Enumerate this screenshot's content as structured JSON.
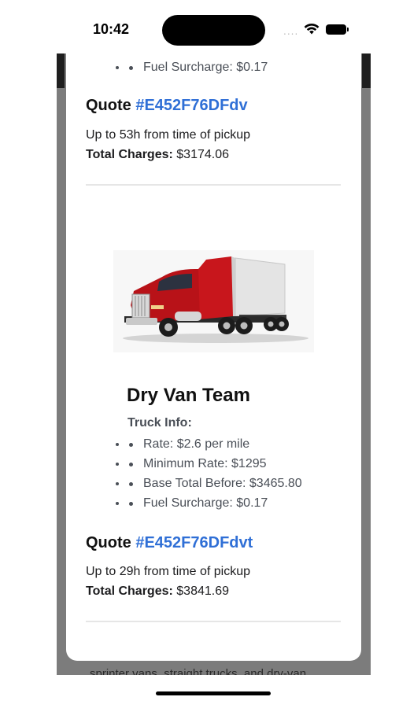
{
  "status_bar": {
    "time": "10:42",
    "signal_dots": "....",
    "icons": [
      "wifi-icon",
      "battery-icon"
    ]
  },
  "modal": {
    "top_list": [
      "Fuel Surcharge: $0.17"
    ],
    "quote1": {
      "prefix": "Quote",
      "id": "#E452F76DFdv",
      "pickup": "Up to 53h from time of pickup",
      "total_label": "Total Charges:",
      "total_value": "$3174.06"
    },
    "truck": {
      "image": "red-semi-truck-with-white-trailer",
      "title": "Dry Van Team",
      "info_label": "Truck Info:",
      "info": [
        "Rate: $2.6 per mile",
        "Minimum Rate: $1295",
        "Base Total Before: $3465.80",
        "Fuel Surcharge: $0.17"
      ]
    },
    "quote2": {
      "prefix": "Quote",
      "id": "#E452F76DFdvt",
      "pickup": "Up to 29h from time of pickup",
      "total_label": "Total Charges:",
      "total_value": "$3841.69"
    }
  },
  "background": {
    "text": "sprinter vans, straight trucks, and dry-van"
  },
  "colors": {
    "link": "#2f6fd6",
    "backdrop": "#7c7c7c",
    "truck_red": "#c8161c"
  }
}
